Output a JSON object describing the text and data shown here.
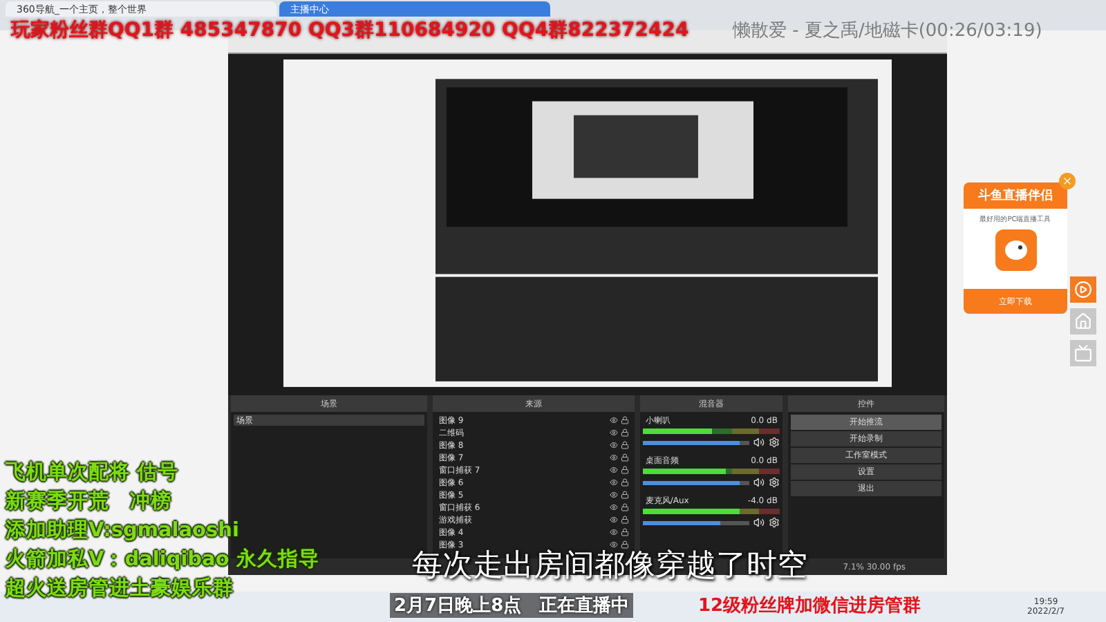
{
  "browser_tabs": [
    {
      "label": "360导航_一个主页，整个世界",
      "selected": false
    },
    {
      "label": "主播中心",
      "selected": true
    }
  ],
  "overlay_top": {
    "groups": "玩家粉丝群QQ1群 485347870 QQ3群110684920 QQ4群822372424",
    "song": "懒散爱 - 夏之禹/地磁卡(00:26/03:19)"
  },
  "obs": {
    "docks": {
      "scenes_title": "场景",
      "sources_title": "来源",
      "mixer_title": "混音器",
      "controls_title": "控件"
    },
    "scenes": [
      {
        "label": "场景",
        "selected": true
      }
    ],
    "sources": [
      "图像 9",
      "二维码",
      "图像 8",
      "图像 7",
      "窗口捕获 7",
      "图像 6",
      "图像 5",
      "窗口捕获 6",
      "游戏捕获",
      "图像 4",
      "图像 3"
    ],
    "mixer": [
      {
        "name": "小喇叭",
        "reading": "0.0 dB",
        "level": 0.9,
        "meter": {
          "level": 0.5
        }
      },
      {
        "name": "桌面音频",
        "reading": "0.0 dB",
        "level": 0.9,
        "meter": {
          "level": 0.6
        }
      },
      {
        "name": "麦克风/Aux",
        "reading": "-4.0 dB",
        "level": 0.72,
        "meter": {
          "level": 0.7
        }
      }
    ],
    "controls": [
      {
        "label": "开始推流",
        "selected": true
      },
      {
        "label": "开始录制",
        "selected": false
      },
      {
        "label": "工作室模式",
        "selected": false
      },
      {
        "label": "设置",
        "selected": false
      },
      {
        "label": "退出",
        "selected": false
      }
    ],
    "status": "7.1% 30.00 fps"
  },
  "overlay_left": [
    "飞机单次配将 估号",
    "新赛季开荒　冲榜",
    "添加助理V:sgmalaoshi",
    "火箭加私V：daliqibao 永久指导",
    "超火送房管进土豪娱乐群"
  ],
  "subtitle": "每次走出房间都像穿越了时空",
  "overlay_bottom": {
    "schedule": "2月7日晚上8点　正在直播中",
    "notice": "12级粉丝牌加微信进房管群"
  },
  "ad": {
    "title": "斗鱼直播伴侣",
    "subtitle": "最好用的PC端直播工具",
    "button": "立即下载"
  },
  "taskbar": {
    "time": "19:59",
    "date": "2022/2/7"
  }
}
